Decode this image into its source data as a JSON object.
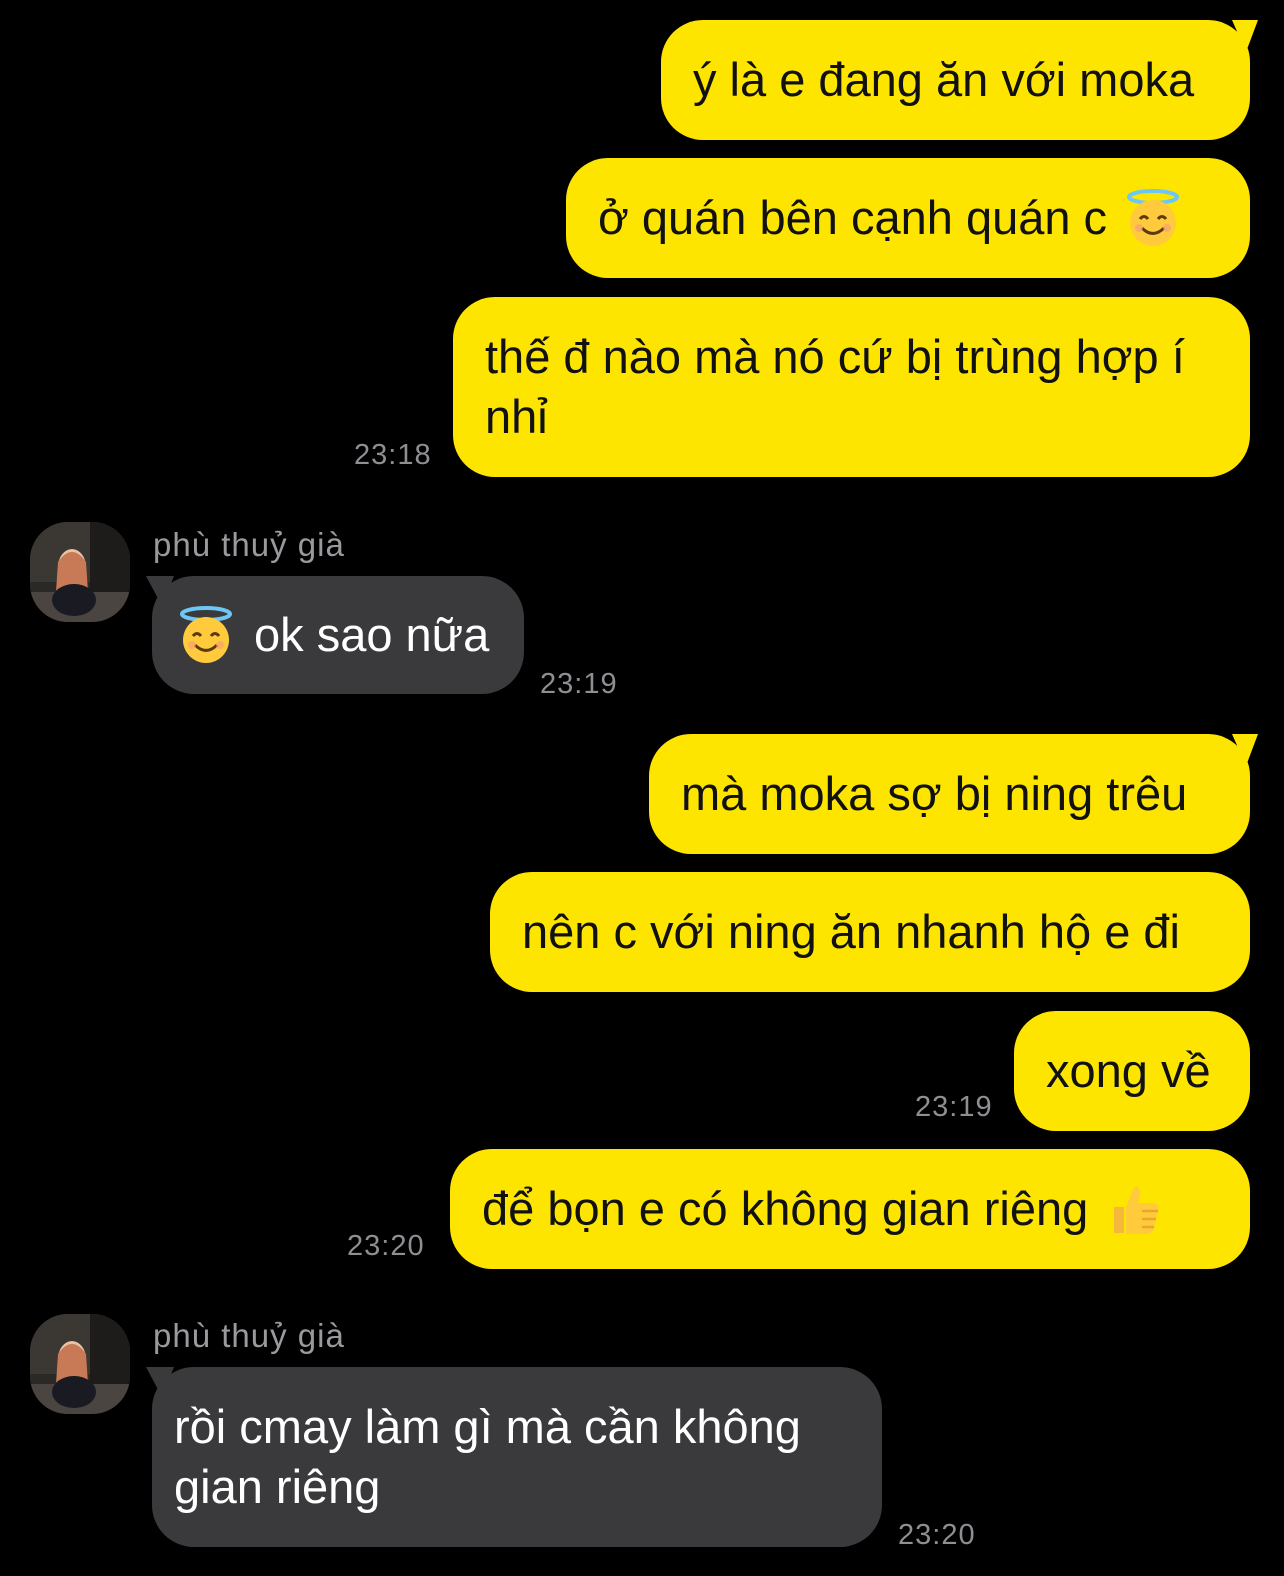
{
  "messages": [
    {
      "text": "ý là e đang ăn với moka"
    },
    {
      "text": "ở quán bên cạnh quán c",
      "emoji": "smiling-face-with-halo-icon"
    },
    {
      "text": "thế đ nào mà nó cứ bị trùng hợp í nhỉ",
      "time": "23:18"
    },
    {
      "sender": "phù thuỷ già",
      "text": "ok sao nữa",
      "emoji": "smiling-face-with-halo-icon",
      "time": "23:19"
    },
    {
      "text": "mà moka sợ bị ning trêu"
    },
    {
      "text": "nên c với ning ăn nhanh hộ e đi"
    },
    {
      "text": "xong về",
      "time": "23:19"
    },
    {
      "text": "để bọn e có không gian riêng",
      "emoji": "thumbs-up-icon",
      "time": "23:20"
    },
    {
      "sender": "phù thuỷ già",
      "text": "rồi cmay làm gì mà cần không gian riêng",
      "time": "23:20"
    }
  ],
  "colors": {
    "background": "#000000",
    "outgoing_bubble": "#FEE500",
    "incoming_bubble": "#3A3A3C",
    "timestamp": "#8E8E93"
  }
}
